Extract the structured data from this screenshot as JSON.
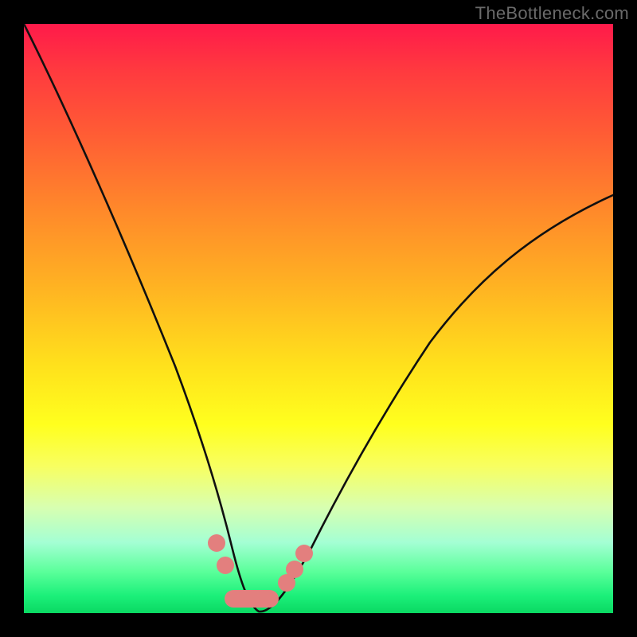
{
  "watermark": "TheBottleneck.com",
  "chart_data": {
    "type": "line",
    "title": "",
    "xlabel": "",
    "ylabel": "",
    "xlim": [
      0,
      100
    ],
    "ylim": [
      0,
      100
    ],
    "series": [
      {
        "name": "bottleneck-curve",
        "x": [
          0,
          4,
          8,
          12,
          16,
          20,
          24,
          27,
          29,
          31,
          33,
          34.5,
          36,
          38,
          40,
          43,
          47,
          52,
          58,
          65,
          73,
          82,
          92,
          100
        ],
        "y": [
          100,
          88,
          77,
          66,
          56,
          46,
          36,
          27,
          21,
          15,
          9,
          4,
          1,
          0,
          0.5,
          2,
          5,
          10,
          17,
          26,
          36,
          47,
          58,
          67
        ]
      }
    ],
    "optimal_markers": {
      "left_points_x": [
        30.5,
        32.0
      ],
      "left_points_y": [
        12.5,
        8.0
      ],
      "right_points_x": [
        42.0,
        43.2,
        44.8
      ],
      "right_points_y": [
        5.0,
        7.0,
        9.5
      ],
      "flat_segment": {
        "x0": 32.5,
        "x1": 40.0,
        "y": 2.2
      }
    },
    "gradient_bands": [
      {
        "pos": 0.0,
        "color": "#ff1a4a"
      },
      {
        "pos": 0.5,
        "color": "#ffe11c"
      },
      {
        "pos": 0.85,
        "color": "#d8ffb0"
      },
      {
        "pos": 1.0,
        "color": "#0ad862"
      }
    ]
  }
}
